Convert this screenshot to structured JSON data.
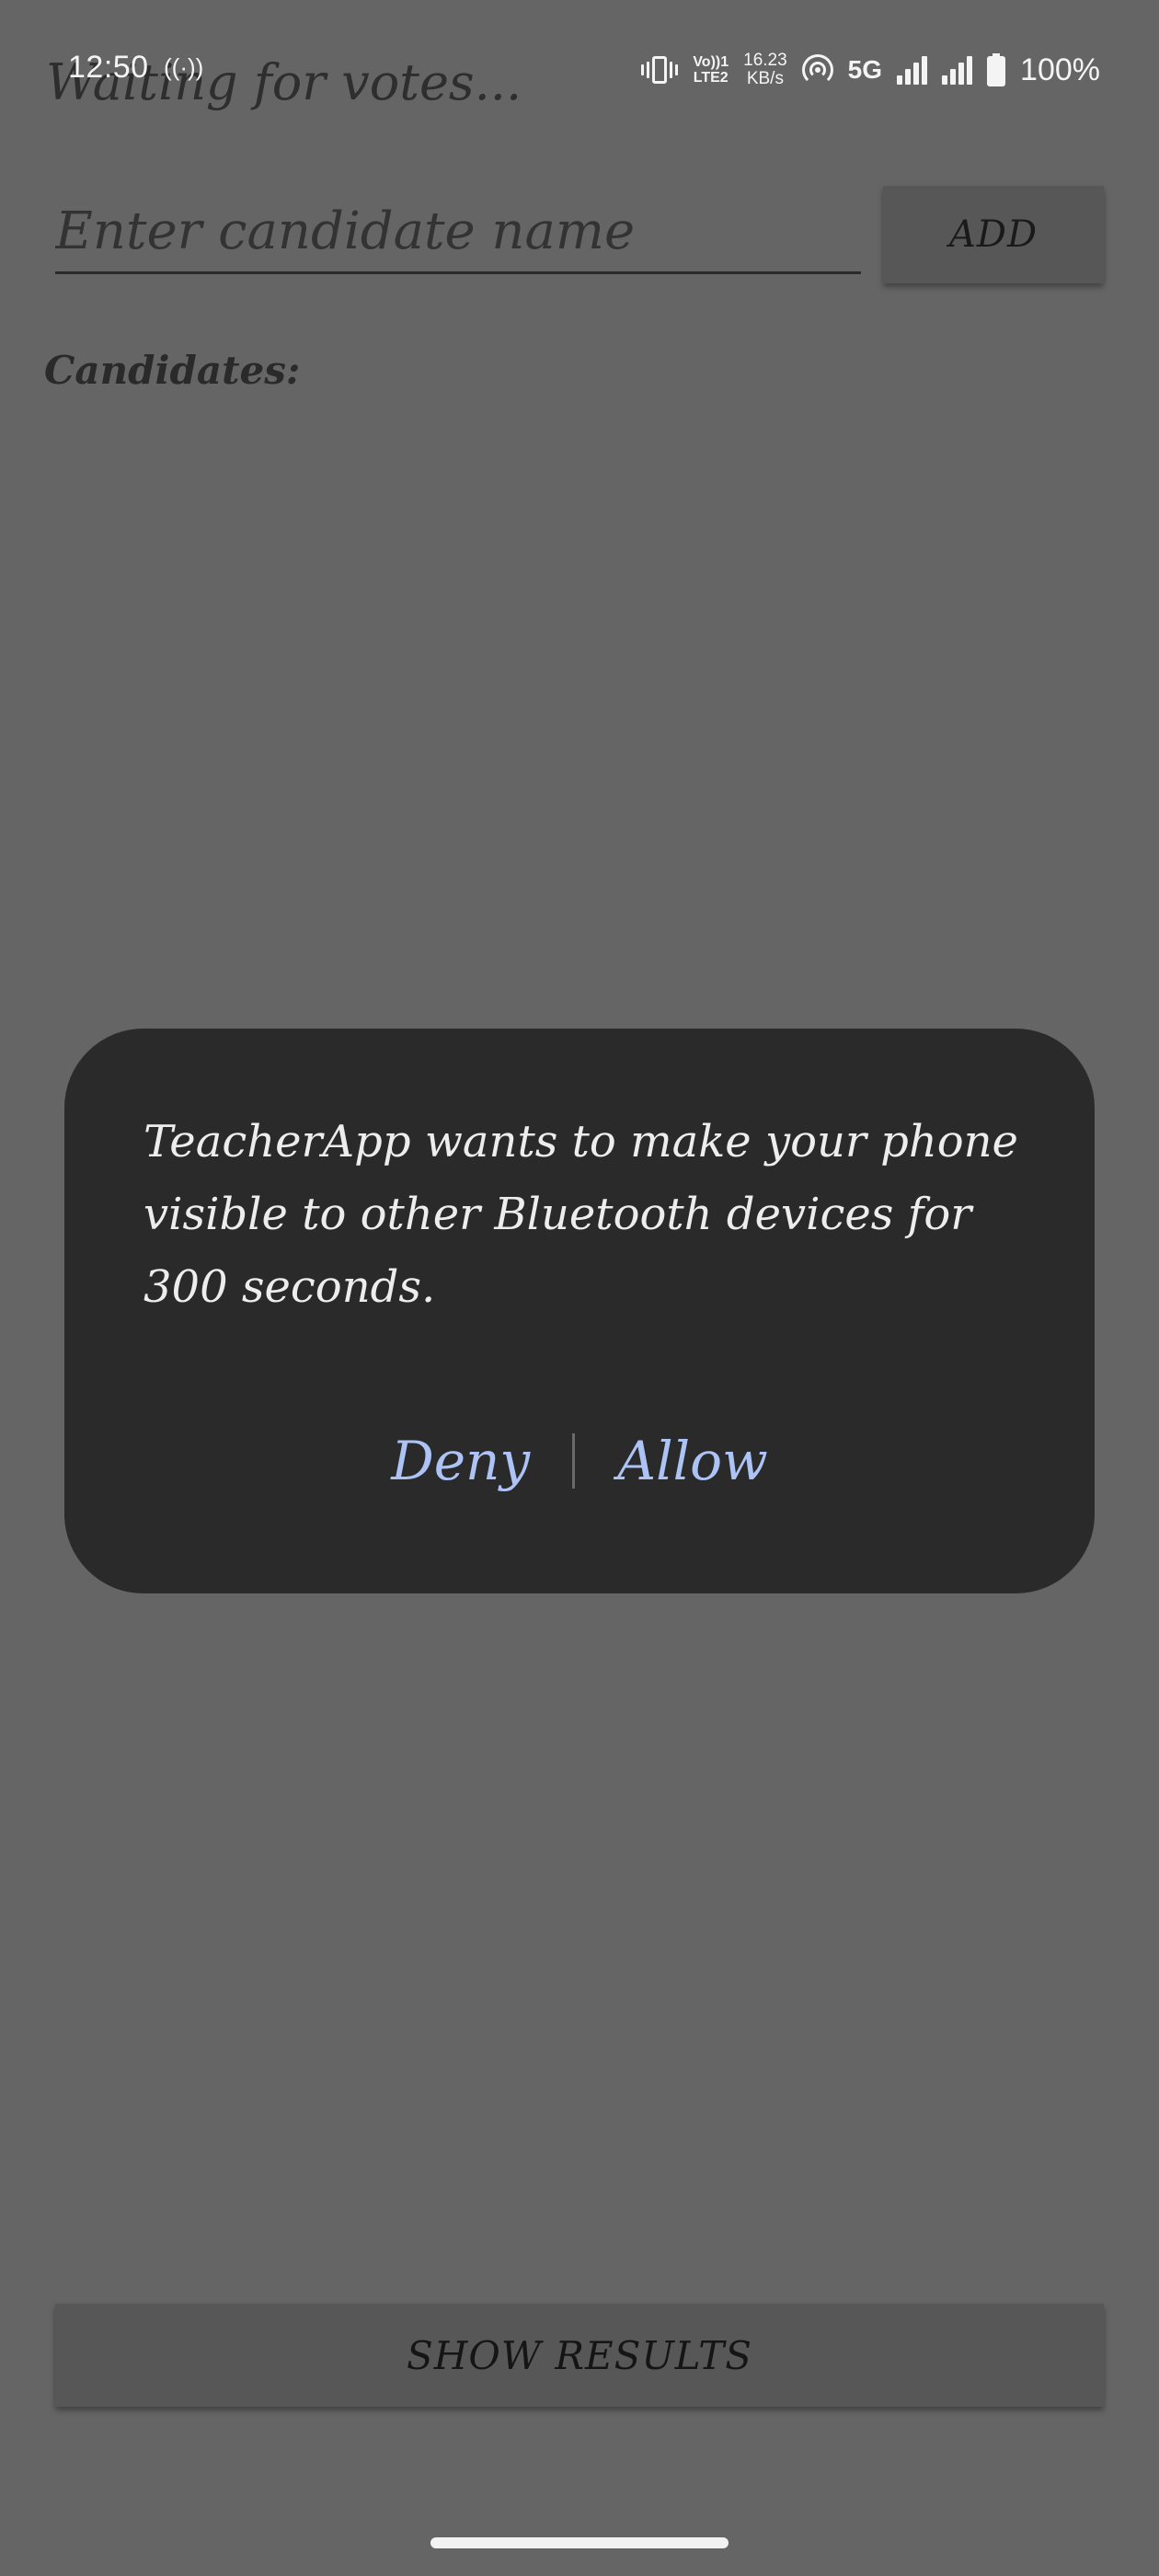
{
  "status_bar": {
    "time": "12:50",
    "hotspot_symbol": "((·))",
    "volte_top": "Vo))1",
    "volte_bottom": "LTE2",
    "speed_top": "16.23",
    "speed_bottom": "KB/s",
    "network": "5G",
    "battery": "100%",
    "icons": [
      "vibrate-icon",
      "hotspot-icon",
      "signal-icon",
      "battery-icon"
    ]
  },
  "app": {
    "heading": "Waiting for votes...",
    "candidate_input_placeholder": "Enter candidate name",
    "candidate_input_value": "",
    "add_label": "ADD",
    "candidates_label": "Candidates:",
    "candidates": [],
    "show_results_label": "SHOW RESULTS"
  },
  "dialog": {
    "message": "TeacherApp wants to make your phone visible to other Bluetooth devices for 300 seconds.",
    "deny_label": "Deny",
    "allow_label": "Allow"
  },
  "colors": {
    "scrim_background": "#656565",
    "dialog_background": "#2a2a2a",
    "dialog_text": "#ededed",
    "dialog_action": "#aec3f5",
    "button_background": "#575757"
  }
}
